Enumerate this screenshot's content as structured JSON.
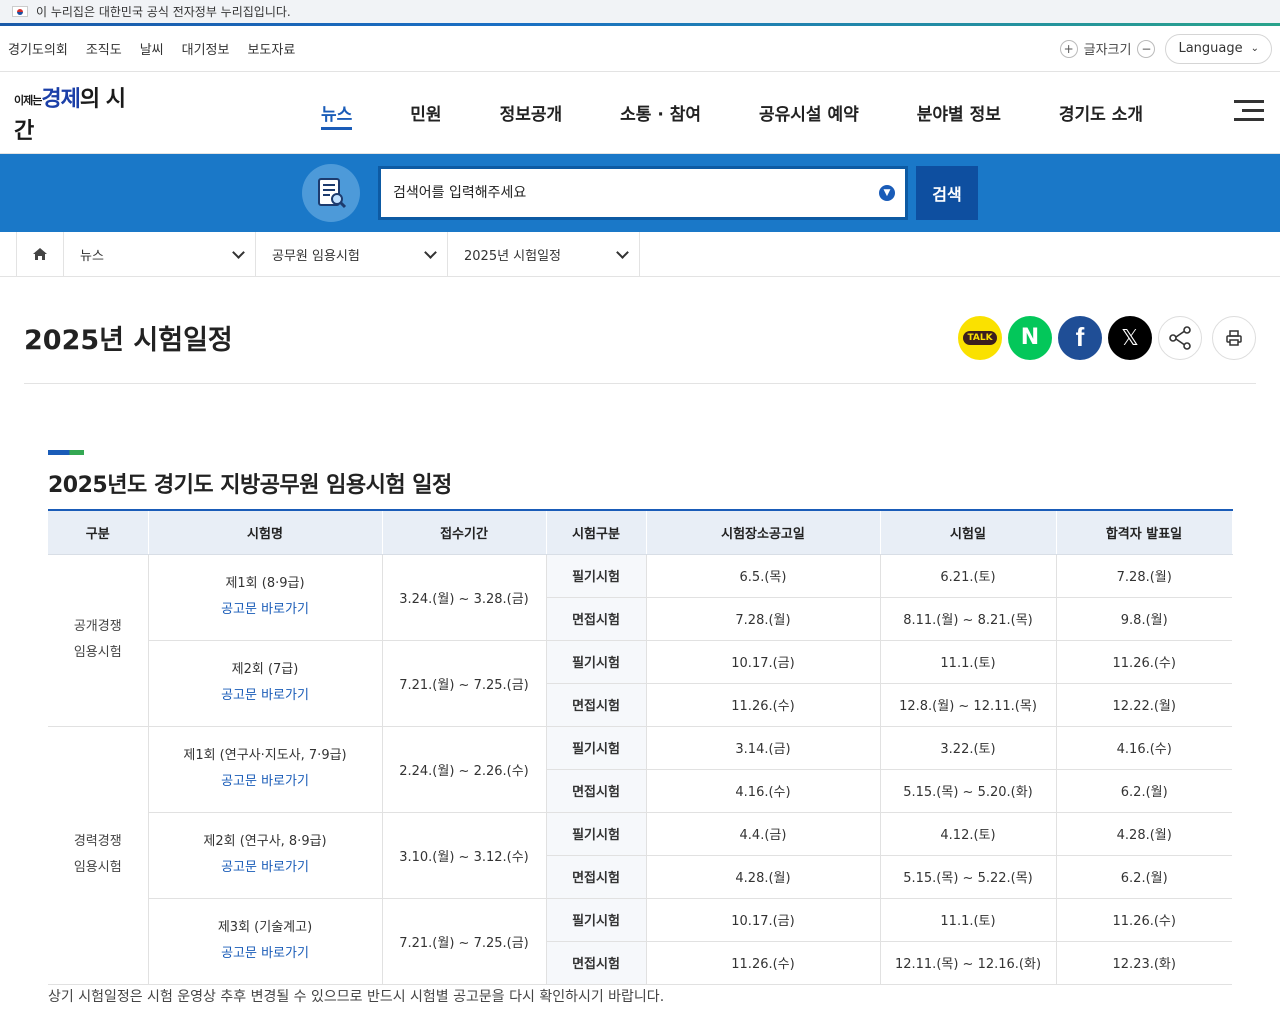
{
  "gov_banner": {
    "text": "이 누리집은 대한민국 공식 전자정부 누리집입니다."
  },
  "util": {
    "links": [
      "경기도의회",
      "조직도",
      "날씨",
      "대기정보",
      "보도자료"
    ],
    "font_size_label": "글자크기",
    "language_label": "Language"
  },
  "header": {
    "logo_text": {
      "small": "이제는",
      "blue": "경제",
      "rest": "의 시간"
    },
    "gnb": [
      "뉴스",
      "민원",
      "정보공개",
      "소통 · 참여",
      "공유시설 예약",
      "분야별 정보",
      "경기도 소개"
    ],
    "active_index": 0
  },
  "search": {
    "placeholder": "검색어를 입력해주세요",
    "button_label": "검색"
  },
  "breadcrumb": {
    "items": [
      "뉴스",
      "공무원 임용시험",
      "2025년 시험일정"
    ]
  },
  "page": {
    "title": "2025년 시험일정",
    "share": {
      "kakao": "TALK",
      "naver": "N",
      "facebook": "f",
      "x": "𝕏"
    }
  },
  "section": {
    "title": "2025년도 경기도 지방공무원 임용시험 일정",
    "headers": [
      "구분",
      "시험명",
      "접수기간",
      "시험구분",
      "시험장소공고일",
      "시험일",
      "합격자 발표일"
    ],
    "link_label": "공고문 바로가기",
    "groups": [
      {
        "name_line1": "공개경쟁",
        "name_line2": "임용시험",
        "exams": [
          {
            "name": "제1회 (8·9급)",
            "period": "3.24.(월) ~ 3.28.(금)",
            "rows": [
              {
                "kind": "필기시험",
                "notice": "6.5.(목)",
                "date": "6.21.(토)",
                "result": "7.28.(월)"
              },
              {
                "kind": "면접시험",
                "notice": "7.28.(월)",
                "date": "8.11.(월) ~ 8.21.(목)",
                "result": "9.8.(월)"
              }
            ]
          },
          {
            "name": "제2회 (7급)",
            "period": "7.21.(월) ~ 7.25.(금)",
            "rows": [
              {
                "kind": "필기시험",
                "notice": "10.17.(금)",
                "date": "11.1.(토)",
                "result": "11.26.(수)"
              },
              {
                "kind": "면접시험",
                "notice": "11.26.(수)",
                "date": "12.8.(월) ~ 12.11.(목)",
                "result": "12.22.(월)"
              }
            ]
          }
        ]
      },
      {
        "name_line1": "경력경쟁",
        "name_line2": "임용시험",
        "exams": [
          {
            "name": "제1회 (연구사·지도사, 7·9급)",
            "period": "2.24.(월) ~ 2.26.(수)",
            "rows": [
              {
                "kind": "필기시험",
                "notice": "3.14.(금)",
                "date": "3.22.(토)",
                "result": "4.16.(수)"
              },
              {
                "kind": "면접시험",
                "notice": "4.16.(수)",
                "date": "5.15.(목) ~ 5.20.(화)",
                "result": "6.2.(월)"
              }
            ]
          },
          {
            "name": "제2회 (연구사, 8·9급)",
            "period": "3.10.(월) ~ 3.12.(수)",
            "rows": [
              {
                "kind": "필기시험",
                "notice": "4.4.(금)",
                "date": "4.12.(토)",
                "result": "4.28.(월)"
              },
              {
                "kind": "면접시험",
                "notice": "4.28.(월)",
                "date": "5.15.(목) ~ 5.22.(목)",
                "result": "6.2.(월)"
              }
            ]
          },
          {
            "name": "제3회 (기술계고)",
            "period": "7.21.(월) ~ 7.25.(금)",
            "rows": [
              {
                "kind": "필기시험",
                "notice": "10.17.(금)",
                "date": "11.1.(토)",
                "result": "11.26.(수)"
              },
              {
                "kind": "면접시험",
                "notice": "11.26.(수)",
                "date": "12.11.(목) ~ 12.16.(화)",
                "result": "12.23.(화)"
              }
            ]
          }
        ]
      }
    ],
    "note": "상기 시험일정은 시험 운영상 추후 변경될 수 있으므로 반드시 시험별 공고문을 다시 확인하시기 바랍니다."
  },
  "colors": {
    "accent": "#1a5cb8",
    "search_bg": "#1a78c8",
    "table_head": "#e8eef6"
  }
}
